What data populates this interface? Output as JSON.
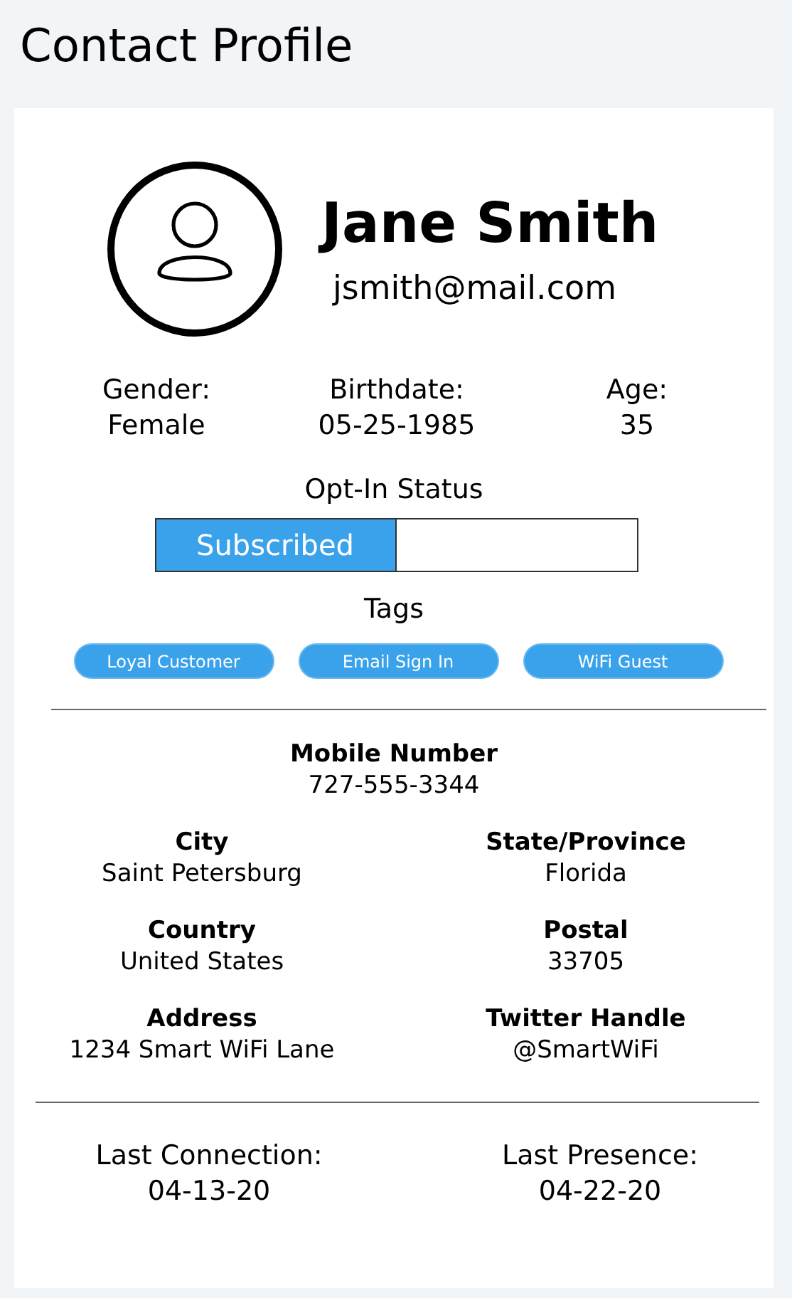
{
  "title": "Contact Profile",
  "profile": {
    "name": "Jane Smith",
    "email": "jsmith@mail.com"
  },
  "facts": [
    {
      "label": "Gender:",
      "value": "Female"
    },
    {
      "label": "Birthdate:",
      "value": "05-25-1985"
    },
    {
      "label": "Age:",
      "value": "35"
    }
  ],
  "opt_in": {
    "label": "Opt-In Status",
    "status": "Subscribed",
    "subscribed": true
  },
  "tags": {
    "label": "Tags",
    "items": [
      "Loyal Customer",
      "Email Sign In",
      "WiFi Guest"
    ]
  },
  "details": [
    {
      "kind": "wide",
      "label": "Mobile Number",
      "value": "727-555-3344"
    },
    {
      "kind": "half",
      "label": "City",
      "value": "Saint Petersburg"
    },
    {
      "kind": "half",
      "label": "State/Province",
      "value": "Florida"
    },
    {
      "kind": "half",
      "label": "Country",
      "value": "United States"
    },
    {
      "kind": "half",
      "label": "Postal",
      "value": "33705"
    },
    {
      "kind": "half",
      "label": "Address",
      "value": "1234 Smart WiFi Lane"
    },
    {
      "kind": "half",
      "label": "Twitter Handle",
      "value": "@SmartWiFi"
    }
  ],
  "activity": [
    {
      "label": "Last Connection:",
      "value": "04-13-20"
    },
    {
      "label": "Last Presence:",
      "value": "04-22-20"
    }
  ]
}
